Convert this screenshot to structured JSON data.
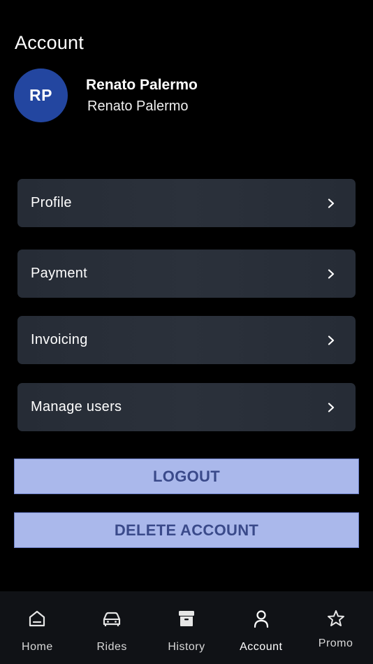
{
  "header": {
    "title": "Account"
  },
  "user": {
    "initials": "RP",
    "name": "Renato Palermo",
    "subtitle": "Renato Palermo"
  },
  "menu": [
    {
      "label": "Profile"
    },
    {
      "label": "Payment"
    },
    {
      "label": "Invoicing"
    },
    {
      "label": "Manage users"
    }
  ],
  "actions": {
    "logout": "LOGOUT",
    "delete": "DELETE ACCOUNT"
  },
  "tabs": [
    {
      "label": "Home",
      "icon": "home-icon"
    },
    {
      "label": "Rides",
      "icon": "car-icon"
    },
    {
      "label": "History",
      "icon": "archive-icon"
    },
    {
      "label": "Account",
      "icon": "user-icon",
      "active": true
    },
    {
      "label": "Promo",
      "icon": "star-icon"
    }
  ],
  "colors": {
    "accent": "#aab8eb",
    "avatar": "#2346a0",
    "background": "#000000",
    "card": "#2a3039",
    "tabbar": "#101216"
  }
}
